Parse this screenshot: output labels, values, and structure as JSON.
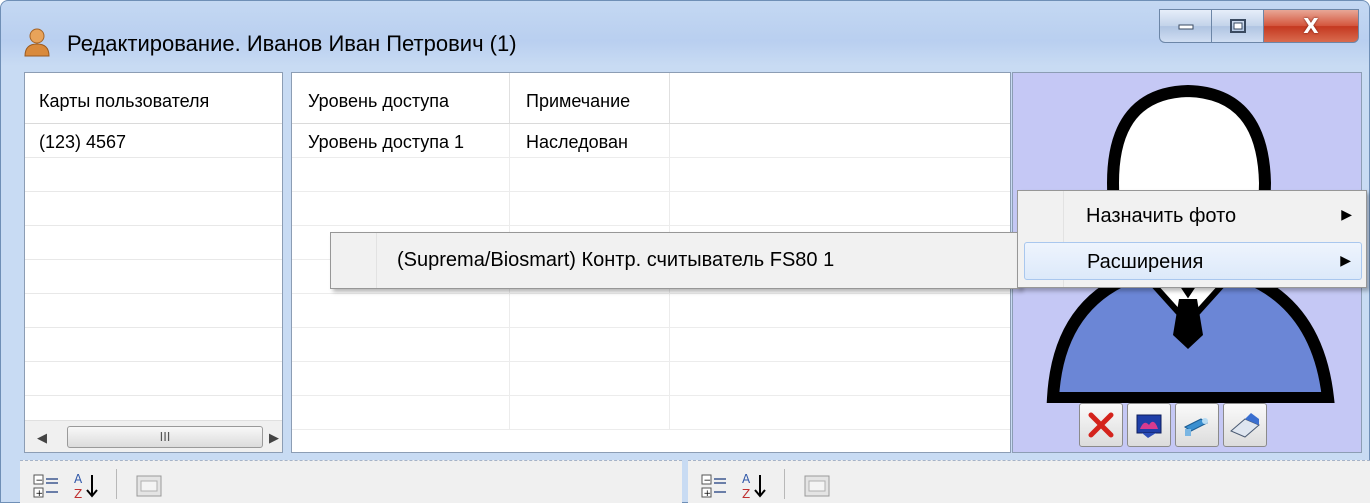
{
  "window": {
    "title": "Редактирование. Иванов Иван Петрович (1)",
    "minimize_icon": "minimize-icon",
    "maximize_icon": "maximize-icon",
    "close_label": "X"
  },
  "cards_panel": {
    "header": "Карты пользователя",
    "rows": [
      "(123) 4567",
      "",
      "",
      "",
      "",
      "",
      "",
      ""
    ],
    "scrollbar_thumb_grip": "III"
  },
  "access_table": {
    "columns": [
      "Уровень доступа",
      "Примечание",
      ""
    ],
    "rows": [
      [
        "Уровень доступа 1",
        "Наследован",
        ""
      ],
      [
        "",
        "",
        ""
      ],
      [
        "",
        "",
        ""
      ],
      [
        "",
        "",
        ""
      ],
      [
        "",
        "",
        ""
      ],
      [
        "",
        "",
        ""
      ],
      [
        "",
        "",
        ""
      ],
      [
        "",
        "",
        ""
      ],
      [
        "",
        "",
        ""
      ]
    ]
  },
  "photo_panel": {
    "buttons": [
      "delete-photo-icon",
      "assign-photo-icon",
      "camera-icon",
      "scanner-icon"
    ],
    "accent": "#5c7fc4"
  },
  "context_menu_reader": {
    "item": "(Suprema/Biosmart) Контр. считыватель FS80 1"
  },
  "context_menu_photo": {
    "items": [
      {
        "label": "Назначить фото",
        "submenu": "▶"
      },
      {
        "label": "Расширения",
        "submenu": "▶"
      }
    ]
  },
  "toolbar_left": {
    "icons": [
      "categorized-icon",
      "sort-az-icon",
      "property-pages-icon"
    ]
  },
  "toolbar_right": {
    "icons": [
      "categorized-icon",
      "sort-az-icon",
      "property-pages-icon"
    ]
  }
}
